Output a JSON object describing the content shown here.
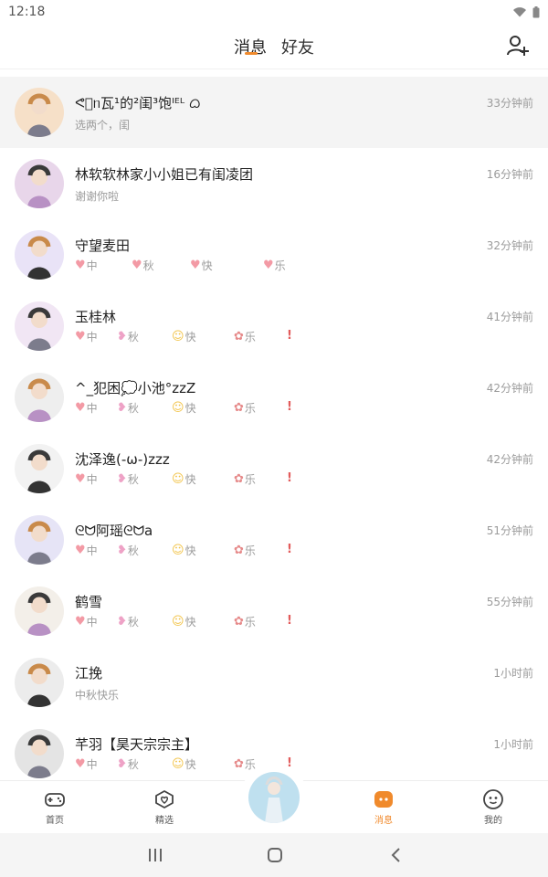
{
  "status_bar": {
    "time": "12:18"
  },
  "header": {
    "tabs": [
      {
        "label": "消息",
        "active": true
      },
      {
        "label": "好友",
        "active": false
      }
    ],
    "add_friend_icon": "person-add-icon"
  },
  "conversations": [
    {
      "name": "ᕙ᷁ᥒ瓦¹的²闺³饱ᴵᴱᴸ ᜊ",
      "time": "33分钟前",
      "preview": "选两个，闺",
      "highlighted": true,
      "avatar_color": "#f6e0c8"
    },
    {
      "name": "林软软林家小小姐已有闺凌团",
      "time": "16分钟前",
      "preview": "谢谢你啦",
      "highlighted": false,
      "avatar_color": "#e8d6ea"
    },
    {
      "name": "守望麦田",
      "time": "32分钟前",
      "emojis": [
        "中",
        "秋",
        "快",
        "乐"
      ],
      "emoji_style": "hearts",
      "highlighted": false,
      "avatar_color": "#e9e3f7"
    },
    {
      "name": "玉桂林",
      "time": "41分钟前",
      "emojis": [
        "中",
        "秋",
        "快",
        "乐"
      ],
      "emoji_style": "mixed",
      "highlighted": false,
      "avatar_color": "#f1e6f4"
    },
    {
      "name": "^_犯困💭小池°zzZ",
      "time": "42分钟前",
      "emojis": [
        "中",
        "秋",
        "快",
        "乐"
      ],
      "emoji_style": "mixed",
      "highlighted": false,
      "avatar_color": "#eeeeee"
    },
    {
      "name": "沈泽逸(-ω-)zzz",
      "time": "42分钟前",
      "emojis": [
        "中",
        "秋",
        "快",
        "乐"
      ],
      "emoji_style": "mixed",
      "highlighted": false,
      "avatar_color": "#f2f2f2"
    },
    {
      "name": "ᘓᗢ阿瑶ᘓᗢa",
      "time": "51分钟前",
      "emojis": [
        "中",
        "秋",
        "快",
        "乐"
      ],
      "emoji_style": "mixed",
      "highlighted": false,
      "avatar_color": "#e6e4f6"
    },
    {
      "name": "鹤雪",
      "time": "55分钟前",
      "emojis": [
        "中",
        "秋",
        "快",
        "乐"
      ],
      "emoji_style": "mixed",
      "highlighted": false,
      "avatar_color": "#f3efe9"
    },
    {
      "name": "江挽",
      "time": "1小时前",
      "preview": "中秋快乐",
      "highlighted": false,
      "avatar_color": "#ececec"
    },
    {
      "name": "芊羽【昊天宗宗主】",
      "time": "1小时前",
      "emojis": [
        "中",
        "秋",
        "快",
        "乐"
      ],
      "emoji_style": "mixed",
      "highlighted": false,
      "avatar_color": "#e4e4e4"
    }
  ],
  "bottom_nav": {
    "items": [
      {
        "label": "首页",
        "icon": "gamepad-icon",
        "active": false
      },
      {
        "label": "精选",
        "icon": "heart-badge-icon",
        "active": false
      },
      {
        "label": "消息",
        "icon": "message-icon",
        "active": true
      },
      {
        "label": "我的",
        "icon": "face-icon",
        "active": false
      }
    ]
  },
  "colors": {
    "accent": "#f08a2c",
    "secondary_text": "#9b9b9b",
    "highlight_row": "#f4f4f4"
  }
}
